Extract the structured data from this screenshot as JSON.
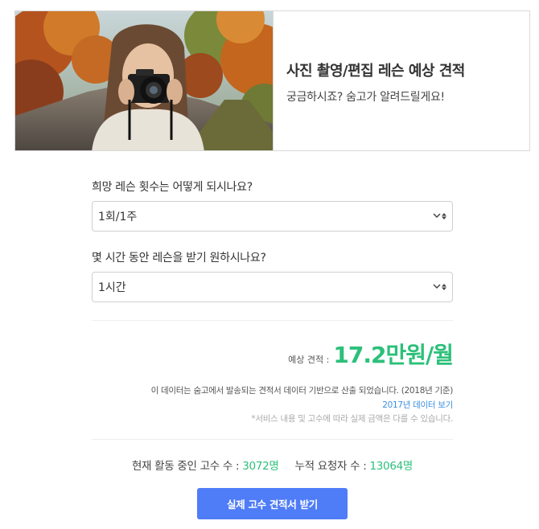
{
  "hero": {
    "title": "사진 촬영/편집 레슨 예상 견적",
    "subtitle": "궁금하시죠? 숨고가 알려드릴게요!"
  },
  "questions": [
    {
      "label": "희망 레슨 횟수는 어떻게 되시나요?",
      "selected": "1회/1주"
    },
    {
      "label": "몇 시간 동안 레슨을 받기 원하시나요?",
      "selected": "1시간"
    }
  ],
  "estimate": {
    "label": "예상 견적 :",
    "value": "17.2만원/월"
  },
  "disclaimer": {
    "source": "이 데이터는 숨고에서 발송되는 견적서 데이터 기반으로 산출 되었습니다. (2018년 기준)",
    "link": "2017년 데이터 보기",
    "note": "*서비스 내용 및 고수에 따라 실제 금액은 다를 수 있습니다."
  },
  "stats": {
    "active_label": "현재 활동 중인 고수 수 :",
    "active_value": "3072명",
    "requests_label": "누적 요청자 수 :",
    "requests_value": "13064명"
  },
  "cta": {
    "label": "실제 고수 견적서 받기"
  },
  "colors": {
    "accent_green": "#2cc07a",
    "cta_blue": "#4f7cf7",
    "link_blue": "#3d8fe0"
  }
}
